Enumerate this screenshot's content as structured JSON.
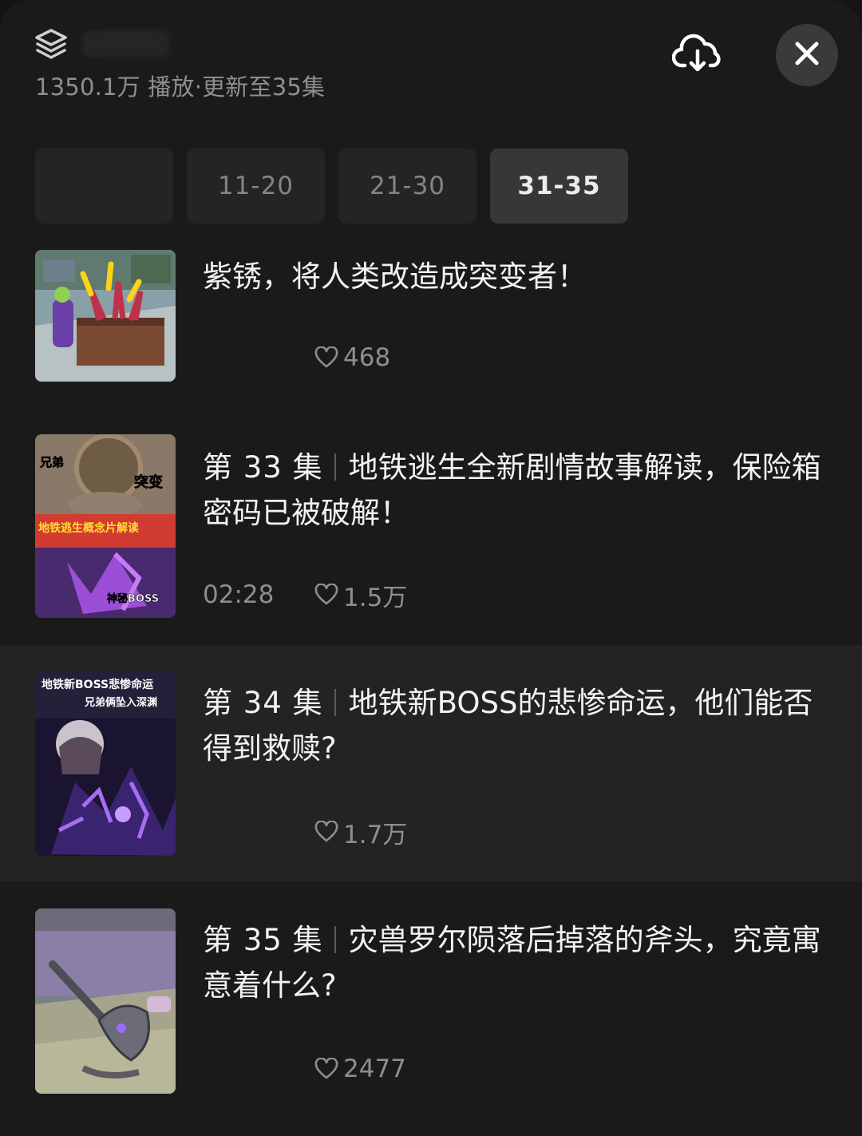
{
  "header": {
    "subtitle": "1350.1万 播放·更新至35集",
    "icons": {
      "collection": "layers-icon",
      "download": "cloud-download-icon",
      "close": "close-icon"
    }
  },
  "tabs": [
    {
      "label": "",
      "active": false
    },
    {
      "label": "11-20",
      "active": false
    },
    {
      "label": "21-30",
      "active": false
    },
    {
      "label": "31-35",
      "active": true
    }
  ],
  "episodes": [
    {
      "number": "",
      "title": "紫锈，将人类改造成突变者！",
      "duration": "",
      "likes": "468",
      "thumb_text": []
    },
    {
      "number": "第 33 集",
      "title": "地铁逃生全新剧情故事解读，保险箱密码已被破解！",
      "duration": "02:28",
      "likes": "1.5万",
      "thumb_text": [
        "兄弟",
        "突变",
        "地铁逃生概念片解读",
        "神秘BOSS"
      ]
    },
    {
      "number": "第 34 集",
      "title": "地铁新BOSS的悲惨命运，他们能否得到救赎?",
      "duration": "",
      "likes": "1.7万",
      "thumb_text": [
        "地铁新BOSS悲惨命运",
        "兄弟俩坠入深渊"
      ]
    },
    {
      "number": "第 35 集",
      "title": "灾兽罗尔陨落后掉落的斧头，究竟寓意着什么?",
      "duration": "",
      "likes": "2477",
      "thumb_text": []
    }
  ],
  "colors": {
    "background": "#1a1a1a",
    "highlight_row": "#232323",
    "tab_bg": "#242424",
    "tab_active_bg": "#373737",
    "muted_text": "#8e8e8e"
  }
}
